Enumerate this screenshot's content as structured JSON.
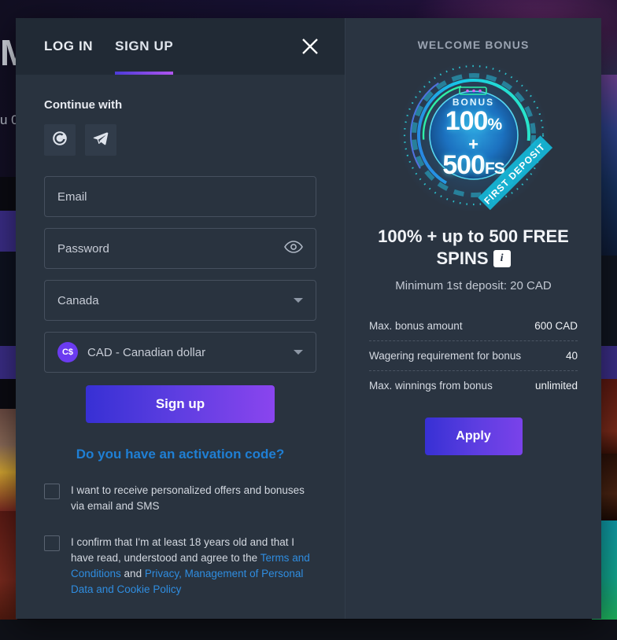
{
  "background": {
    "hero_title": "M",
    "hero_sub": "u\n0"
  },
  "modal": {
    "tabs": [
      {
        "label": "LOG IN",
        "active": false,
        "name": "tab-log-in"
      },
      {
        "label": "SIGN UP",
        "active": true,
        "name": "tab-sign-up"
      }
    ],
    "close_icon": "close-icon"
  },
  "form": {
    "continue_with_label": "Continue with",
    "social": [
      {
        "name": "google-icon",
        "label": "Google"
      },
      {
        "name": "telegram-icon",
        "label": "Telegram"
      }
    ],
    "email": {
      "placeholder": "Email",
      "value": ""
    },
    "password": {
      "placeholder": "Password",
      "value": "",
      "toggle_icon": "eye-icon"
    },
    "country": {
      "value": "Canada",
      "caret_icon": "chevron-down-icon"
    },
    "currency": {
      "badge": "C$",
      "value": "CAD - Canadian dollar",
      "caret_icon": "chevron-down-icon"
    },
    "submit_label": "Sign up",
    "activation_link": "Do you have an activation code?",
    "consent_marketing": {
      "text": "I want to receive personalized offers and bonuses via email and SMS",
      "checked": false
    },
    "consent_terms": {
      "prefix": "I confirm that I'm at least 18 years old and that I have read, understood and agree to the ",
      "link1": "Terms and Conditions",
      "middle": " and ",
      "link2": "Privacy, Management of Personal Data and Cookie Policy",
      "checked": false
    }
  },
  "bonus": {
    "heading": "WELCOME BONUS",
    "badge": {
      "label": "BONUS",
      "percent": "100",
      "percent_sign": "%",
      "plus": "+",
      "spins": "500",
      "spins_unit": "FS",
      "ribbon": "FIRST DEPOSIT"
    },
    "title": "100% + up to 500 FREE SPINS",
    "info_icon": "info-icon",
    "minimum": "Minimum 1st deposit: 20 CAD",
    "details": [
      {
        "label": "Max. bonus amount",
        "value": "600 CAD"
      },
      {
        "label": "Wagering requirement for bonus",
        "value": "40"
      },
      {
        "label": "Max. winnings from bonus",
        "value": "unlimited"
      }
    ],
    "apply_label": "Apply"
  },
  "colors": {
    "accent_purple": "#8a45ee",
    "accent_blue": "#3730d4",
    "link_blue": "#2f8de0",
    "panel_left": "#29333f",
    "panel_right": "#2a3441",
    "tabbar": "#212a35",
    "currency_badge": "#6b3bf0"
  }
}
